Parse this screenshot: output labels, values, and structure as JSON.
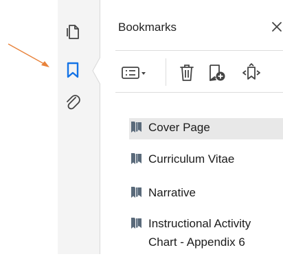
{
  "panel": {
    "title": "Bookmarks",
    "close_icon": "close-icon"
  },
  "rail": {
    "items": [
      {
        "icon": "page-thumbnails-icon",
        "active": false
      },
      {
        "icon": "bookmark-icon",
        "active": true
      },
      {
        "icon": "paperclip-icon",
        "active": false
      }
    ]
  },
  "toolbar": {
    "tools": [
      {
        "icon": "options-menu-icon"
      },
      {
        "icon": "trash-icon"
      },
      {
        "icon": "new-bookmark-icon"
      },
      {
        "icon": "expand-bookmark-icon"
      }
    ]
  },
  "bookmarks": [
    {
      "label": "Cover Page",
      "selected": true
    },
    {
      "label": "Curriculum Vitae",
      "selected": false
    },
    {
      "label": "Narrative",
      "selected": false
    },
    {
      "label": "Instructional Activity Chart - Appendix 6",
      "selected": false
    }
  ],
  "colors": {
    "accent": "#1473e6",
    "annotation_arrow": "#e8823a",
    "bookmark_icon": "#5a6a7a",
    "selected_row": "#e8e8e8"
  }
}
